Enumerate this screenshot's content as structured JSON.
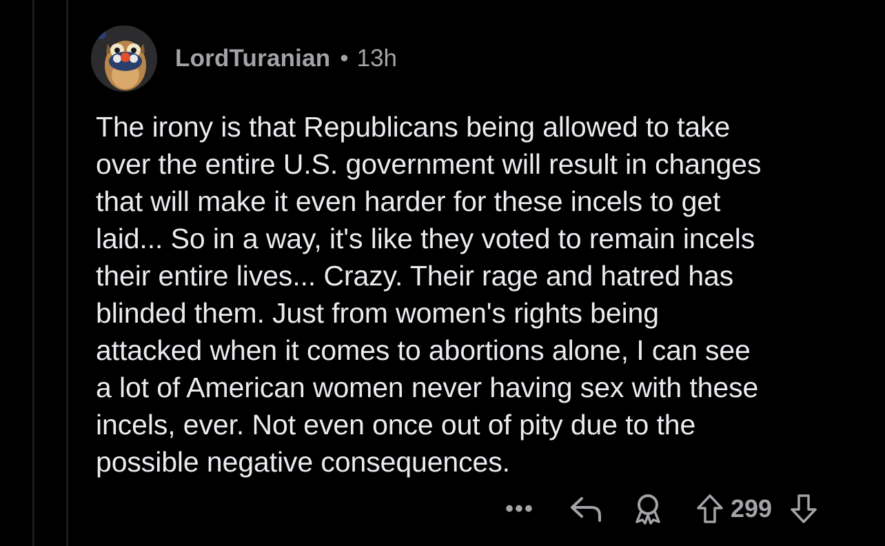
{
  "comment": {
    "username": "LordTuranian",
    "separator": "•",
    "time": "13h",
    "body_lines": [
      "The irony is that Republicans being allowed to take",
      "over the entire U.S. government will result in changes",
      "that will make it even harder for these incels to get",
      "laid... So in a way, it's like they voted to remain incels",
      "their entire lives... Crazy. Their rage and hatred has",
      "blinded them. Just from women's rights being",
      "attacked when it comes to abortions alone, I can see",
      "a lot of American women never having sex with these",
      "incels, ever. Not even once out of pity due to the",
      "possible negative consequences."
    ]
  },
  "actions": {
    "more_label": "•••",
    "score": "299",
    "icons": [
      "more-icon",
      "reply-icon",
      "award-icon",
      "upvote-icon",
      "downvote-icon"
    ]
  },
  "colors": {
    "background": "#000000",
    "body_text": "#ebebf0",
    "meta_text": "#a3a3a8",
    "thread_line": "#1c1c1e"
  }
}
